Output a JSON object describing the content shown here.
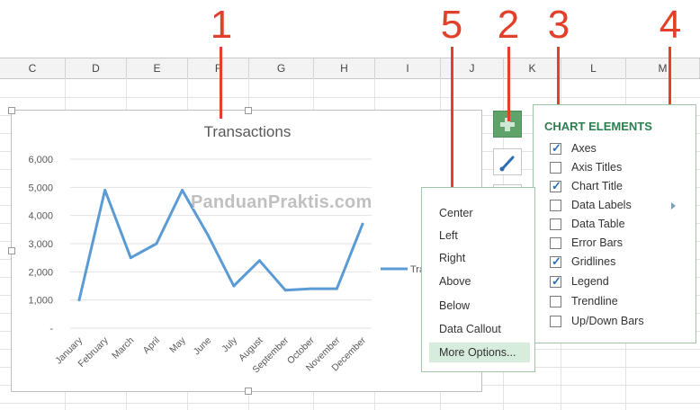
{
  "callouts": [
    "1",
    "5",
    "2",
    "3",
    "4"
  ],
  "columns": [
    "C",
    "D",
    "E",
    "F",
    "G",
    "H",
    "I",
    "J",
    "K",
    "L",
    "M"
  ],
  "chart_data": {
    "type": "line",
    "title": "Transactions",
    "categories": [
      "January",
      "February",
      "March",
      "April",
      "May",
      "June",
      "July",
      "August",
      "September",
      "October",
      "November",
      "December"
    ],
    "series": [
      {
        "name": "Tra",
        "values": [
          1000,
          4900,
          2500,
          3000,
          4900,
          3300,
          1500,
          2400,
          1350,
          1400,
          1400,
          3700
        ]
      }
    ],
    "y_ticks": [
      "6,000",
      "5,000",
      "4,000",
      "3,000",
      "2,000",
      "1,000",
      "-"
    ],
    "ylim": [
      0,
      6000
    ],
    "grid": true,
    "legend_position": "right",
    "line_color": "#5b9bd5"
  },
  "chart_elements": {
    "title": "CHART ELEMENTS",
    "items": [
      {
        "label": "Axes",
        "checked": true
      },
      {
        "label": "Axis Titles",
        "checked": false
      },
      {
        "label": "Chart Title",
        "checked": true
      },
      {
        "label": "Data Labels",
        "checked": false
      },
      {
        "label": "Data Table",
        "checked": false
      },
      {
        "label": "Error Bars",
        "checked": false
      },
      {
        "label": "Gridlines",
        "checked": true
      },
      {
        "label": "Legend",
        "checked": true
      },
      {
        "label": "Trendline",
        "checked": false
      },
      {
        "label": "Up/Down Bars",
        "checked": false
      }
    ]
  },
  "data_labels_menu": {
    "items": [
      "Center",
      "Left",
      "Right",
      "Above",
      "Below",
      "Data Callout"
    ],
    "more": "More Options..."
  },
  "watermark": "PanduanPraktis.com",
  "colors": {
    "accent_green": "#5fa36a",
    "callout_red": "#e2402a",
    "series_blue": "#5b9bd5"
  }
}
